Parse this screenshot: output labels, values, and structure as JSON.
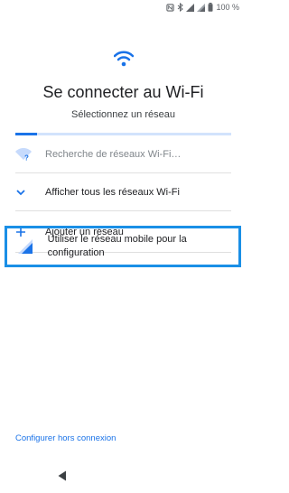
{
  "status_bar": {
    "battery_percent": "100 %",
    "icons": [
      "nfc-icon",
      "bluetooth-icon",
      "signal-icon",
      "cell-signal-icon",
      "battery-icon"
    ]
  },
  "header": {
    "icon": "wifi-icon",
    "title": "Se connecter au Wi-Fi",
    "subtitle": "Sélectionnez un réseau"
  },
  "progress": {
    "value": 0.1,
    "track_color": "#d2e3fc",
    "fill_color": "#1a73e8"
  },
  "list": {
    "items": [
      {
        "label": "Recherche de réseaux Wi-Fi…",
        "icon": "wifi-searching-icon",
        "enabled": false
      },
      {
        "label": "Afficher tous les réseaux Wi-Fi",
        "icon": "chevron-down-icon",
        "enabled": true
      },
      {
        "label": "Ajouter un réseau",
        "icon": "plus-icon",
        "enabled": true
      },
      {
        "label": "Utiliser le réseau mobile pour la configuration",
        "icon": "cell-signal-icon",
        "enabled": true,
        "highlighted": true
      }
    ]
  },
  "footer": {
    "offline_label": "Configurer hors connexion"
  },
  "nav": {
    "back_icon": "back-triangle-icon"
  },
  "colors": {
    "accent": "#1a73e8",
    "highlight_border": "#1a8fe6"
  }
}
